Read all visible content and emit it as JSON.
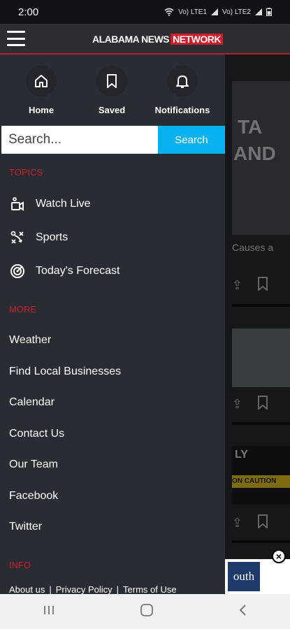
{
  "status": {
    "time": "2:00",
    "net1": "Vo) LTE1",
    "net2": "Vo) LTE2"
  },
  "appbar": {
    "logo_part1": "ALABAMA NEWS",
    "logo_part2": "NETWORK"
  },
  "shortcuts": [
    {
      "label": "Home",
      "icon": "home-icon"
    },
    {
      "label": "Saved",
      "icon": "bookmark-icon"
    },
    {
      "label": "Notifications",
      "icon": "bell-icon"
    }
  ],
  "search": {
    "placeholder": "Search...",
    "button": "Search"
  },
  "topics": {
    "header": "TOPICS",
    "items": [
      {
        "label": "Watch Live",
        "icon": "live-camera-icon"
      },
      {
        "label": "Sports",
        "icon": "sports-playbook-icon"
      },
      {
        "label": "Today's Forecast",
        "icon": "radar-icon"
      }
    ]
  },
  "more": {
    "header": "MORE",
    "items": [
      "Weather",
      "Find Local Businesses",
      "Calendar",
      "Contact Us",
      "Our Team",
      "Facebook",
      "Twitter"
    ]
  },
  "info": {
    "header": "INFO",
    "links": [
      "About us",
      "Privacy Policy",
      "Terms of Use"
    ],
    "separator": "|"
  },
  "background": {
    "headline_fragment": "Causes a",
    "card1_text1": "TA",
    "card1_text2": "AND",
    "card3_text": "LY",
    "caution": "ON CAUTION",
    "ad_text": "outh"
  },
  "colors": {
    "accent_red": "#c81f2a",
    "search_blue": "#0ab1f0",
    "drawer_bg": "#2a2c33"
  }
}
